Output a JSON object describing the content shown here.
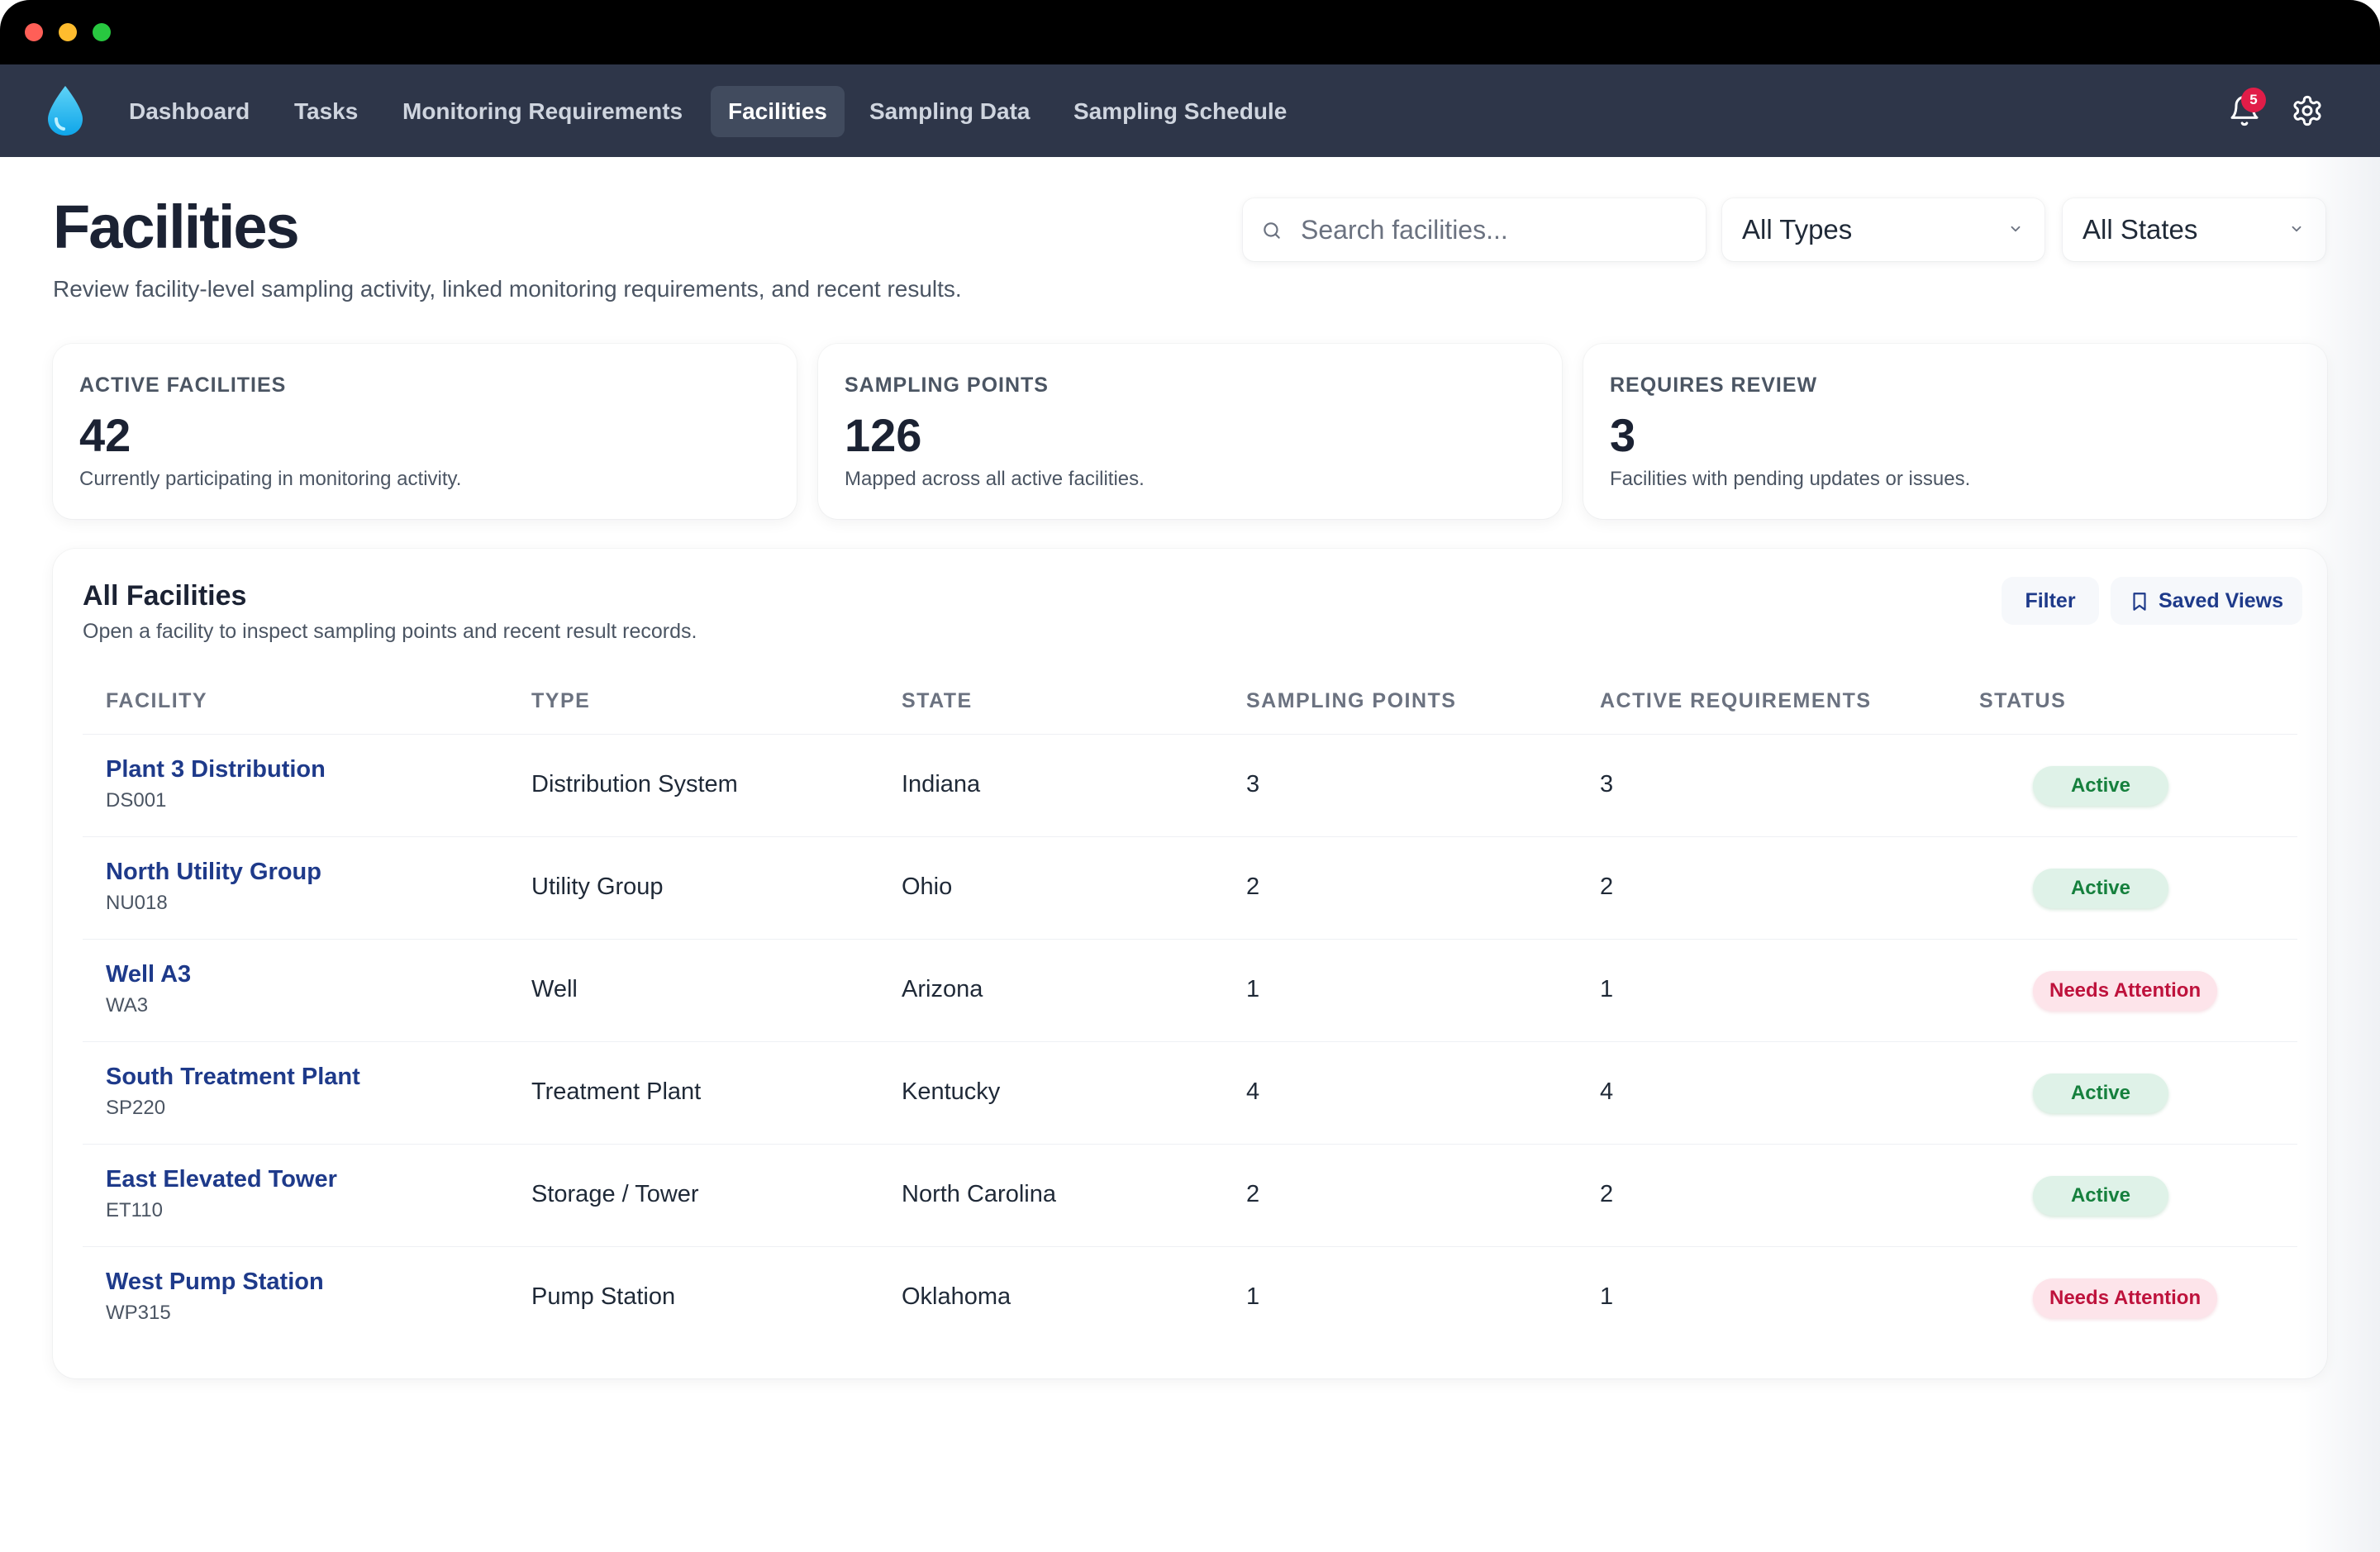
{
  "nav": {
    "items": [
      {
        "label": "Dashboard",
        "active": false
      },
      {
        "label": "Tasks",
        "active": false
      },
      {
        "label": "Monitoring Requirements",
        "active": false
      },
      {
        "label": "Facilities",
        "active": true
      },
      {
        "label": "Sampling Data",
        "active": false
      },
      {
        "label": "Sampling Schedule",
        "active": false
      }
    ],
    "notification_count": "5",
    "icons": {
      "logo": "water-drop-icon",
      "bell": "bell-icon",
      "settings": "gear-icon"
    }
  },
  "header": {
    "title": "Facilities",
    "subtitle": "Review facility-level sampling activity, linked monitoring requirements, and recent results."
  },
  "search": {
    "placeholder": "Search facilities...",
    "value": ""
  },
  "filters": {
    "type_selected": "All Types",
    "state_selected": "All States"
  },
  "stats": [
    {
      "label": "ACTIVE FACILITIES",
      "value": "42",
      "desc": "Currently participating in monitoring activity."
    },
    {
      "label": "SAMPLING POINTS",
      "value": "126",
      "desc": "Mapped across all active facilities."
    },
    {
      "label": "REQUIRES REVIEW",
      "value": "3",
      "desc": "Facilities with pending updates or issues."
    }
  ],
  "table": {
    "title": "All Facilities",
    "subtitle": "Open a facility to inspect sampling points and recent result records.",
    "filter_label": "Filter",
    "saved_views_label": "Saved Views",
    "columns": [
      "FACILITY",
      "TYPE",
      "STATE",
      "SAMPLING POINTS",
      "ACTIVE REQUIREMENTS",
      "STATUS"
    ],
    "rows": [
      {
        "name": "Plant 3 Distribution",
        "code": "DS001",
        "type": "Distribution System",
        "state": "Indiana",
        "sampling_points": "3",
        "active_requirements": "3",
        "status": "Active"
      },
      {
        "name": "North Utility Group",
        "code": "NU018",
        "type": "Utility Group",
        "state": "Ohio",
        "sampling_points": "2",
        "active_requirements": "2",
        "status": "Active"
      },
      {
        "name": "Well A3",
        "code": "WA3",
        "type": "Well",
        "state": "Arizona",
        "sampling_points": "1",
        "active_requirements": "1",
        "status": "Needs Attention"
      },
      {
        "name": "South Treatment Plant",
        "code": "SP220",
        "type": "Treatment Plant",
        "state": "Kentucky",
        "sampling_points": "4",
        "active_requirements": "4",
        "status": "Active"
      },
      {
        "name": "East Elevated Tower",
        "code": "ET110",
        "type": "Storage / Tower",
        "state": "North Carolina",
        "sampling_points": "2",
        "active_requirements": "2",
        "status": "Active"
      },
      {
        "name": "West Pump Station",
        "code": "WP315",
        "type": "Pump Station",
        "state": "Oklahoma",
        "sampling_points": "1",
        "active_requirements": "1",
        "status": "Needs Attention"
      }
    ]
  },
  "colors": {
    "nav_bg": "#2e3649",
    "accent": "#1e3a8a",
    "status_active_bg": "#dff2e8",
    "status_active_text": "#15803d",
    "status_attention_bg": "#fde4ea",
    "status_attention_text": "#be123c",
    "badge": "#e11d48"
  }
}
